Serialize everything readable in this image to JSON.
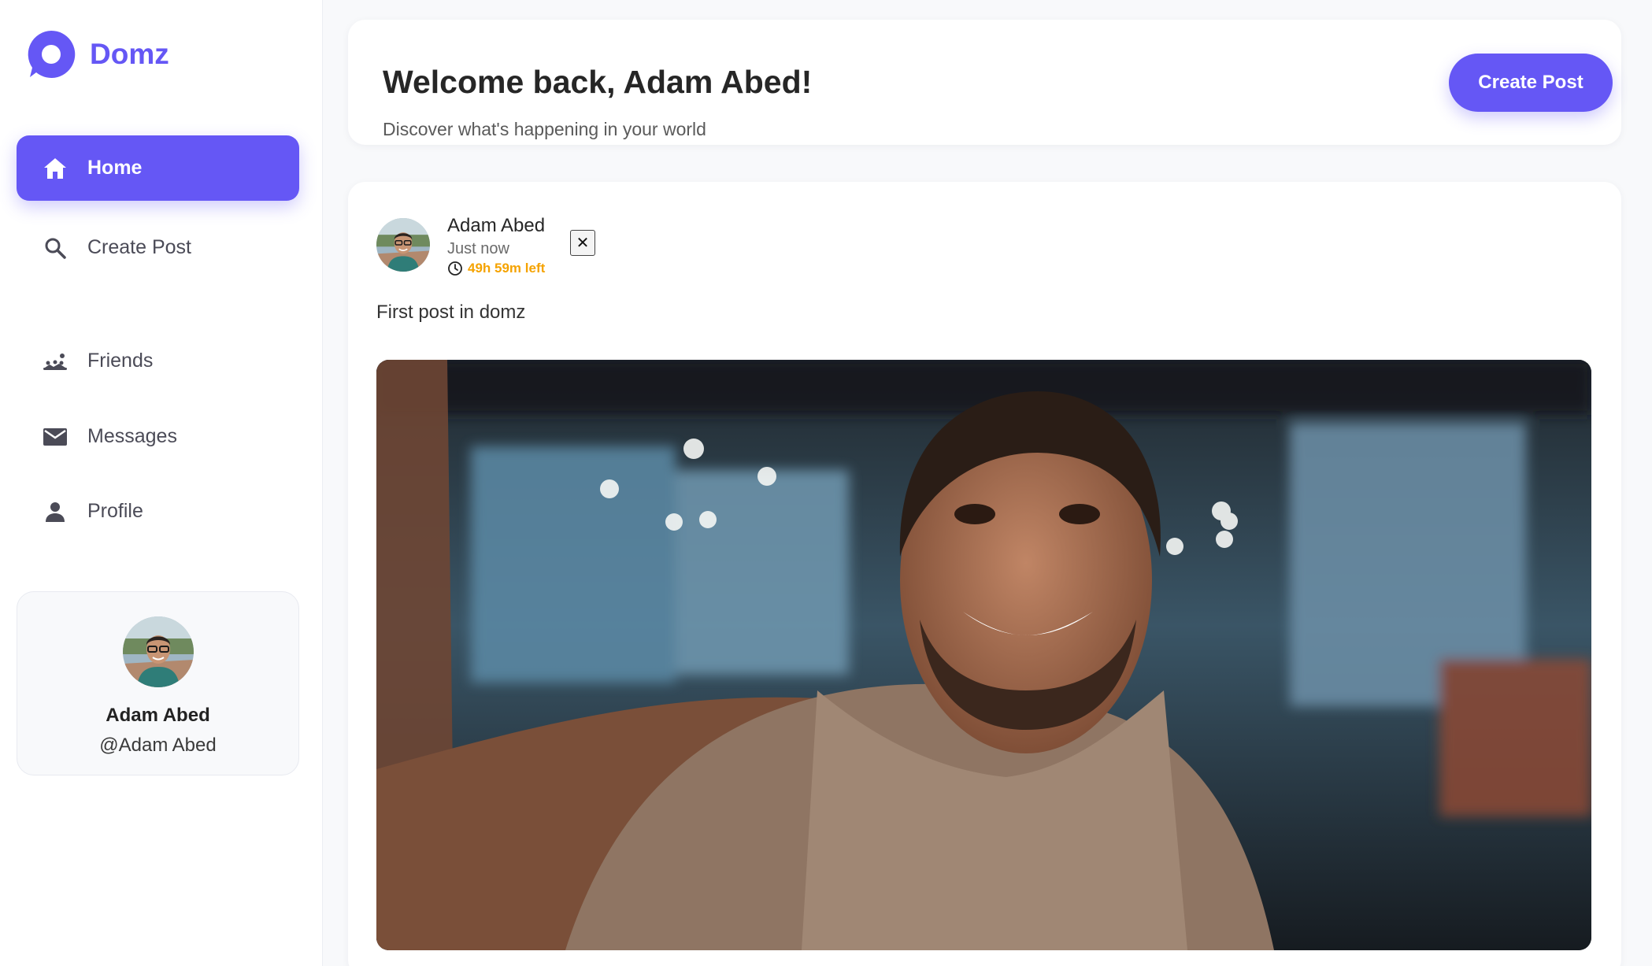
{
  "brand": {
    "name": "Domz",
    "color": "#6557f5"
  },
  "sidebar": {
    "items": [
      {
        "label": "Home",
        "icon": "home-icon",
        "active": true
      },
      {
        "label": "Create Post",
        "icon": "search-icon"
      },
      {
        "label": "Friends",
        "icon": "friends-icon"
      },
      {
        "label": "Messages",
        "icon": "mail-icon"
      },
      {
        "label": "Profile",
        "icon": "person-icon"
      }
    ]
  },
  "user": {
    "name": "Adam Abed",
    "handle": "@Adam Abed"
  },
  "welcome": {
    "title": "Welcome back, Adam Abed!",
    "subtitle": "Discover what's happening in your world",
    "create_label": "Create Post"
  },
  "post": {
    "author": "Adam Abed",
    "time": "Just now",
    "expires": "49h 59m left",
    "close_symbol": "✕",
    "text": "First post in domz",
    "timer_color": "#f5a300"
  }
}
